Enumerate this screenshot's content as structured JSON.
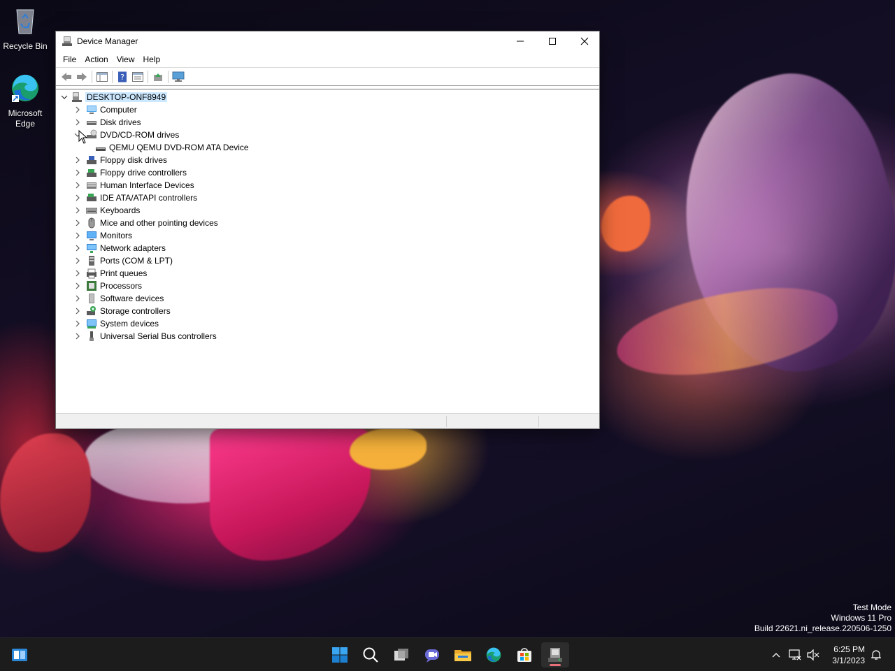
{
  "desktop": {
    "icons": [
      {
        "label": "Recycle Bin"
      },
      {
        "label": "Microsoft Edge"
      }
    ]
  },
  "window": {
    "title": "Device Manager",
    "menu": [
      "File",
      "Action",
      "View",
      "Help"
    ],
    "tree": {
      "root": "DESKTOP-ONF8949",
      "categories": [
        {
          "label": "Computer",
          "expanded": false
        },
        {
          "label": "Disk drives",
          "expanded": false
        },
        {
          "label": "DVD/CD-ROM drives",
          "expanded": true,
          "children": [
            "QEMU QEMU DVD-ROM ATA Device"
          ]
        },
        {
          "label": "Floppy disk drives",
          "expanded": false
        },
        {
          "label": "Floppy drive controllers",
          "expanded": false
        },
        {
          "label": "Human Interface Devices",
          "expanded": false
        },
        {
          "label": "IDE ATA/ATAPI controllers",
          "expanded": false
        },
        {
          "label": "Keyboards",
          "expanded": false
        },
        {
          "label": "Mice and other pointing devices",
          "expanded": false
        },
        {
          "label": "Monitors",
          "expanded": false
        },
        {
          "label": "Network adapters",
          "expanded": false
        },
        {
          "label": "Ports (COM & LPT)",
          "expanded": false
        },
        {
          "label": "Print queues",
          "expanded": false
        },
        {
          "label": "Processors",
          "expanded": false
        },
        {
          "label": "Software devices",
          "expanded": false
        },
        {
          "label": "Storage controllers",
          "expanded": false
        },
        {
          "label": "System devices",
          "expanded": false
        },
        {
          "label": "Universal Serial Bus controllers",
          "expanded": false
        }
      ]
    }
  },
  "watermark": {
    "line1": "Test Mode",
    "line2": "Windows 11 Pro",
    "line3": "Build 22621.ni_release.220506-1250"
  },
  "taskbar": {
    "time": "6:25 PM",
    "date": "3/1/2023",
    "apps": [
      "start-icon",
      "search-icon",
      "task-view-icon",
      "chat-icon",
      "file-explorer-icon",
      "edge-icon",
      "store-icon",
      "device-manager-icon"
    ]
  },
  "colors": {
    "selection": "#cce8ff",
    "taskbar": "#1c1c1c",
    "accent": "#0078d4"
  }
}
